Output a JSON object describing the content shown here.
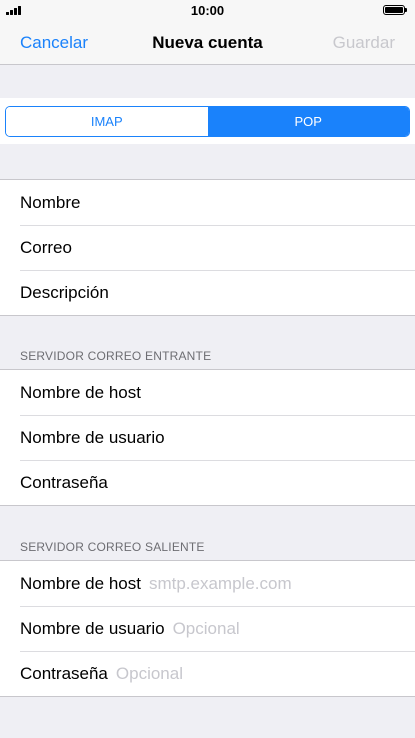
{
  "status_bar": {
    "time": "10:00",
    "signal_icon": "signal-bars-icon",
    "battery_icon": "battery-icon"
  },
  "nav": {
    "cancel": "Cancelar",
    "title": "Nueva cuenta",
    "save": "Guardar"
  },
  "segment": {
    "options": [
      "IMAP",
      "POP"
    ],
    "selected": "POP"
  },
  "account": {
    "fields": [
      "Nombre",
      "Correo",
      "Descripción"
    ]
  },
  "incoming": {
    "header": "SERVIDOR CORREO ENTRANTE",
    "fields": [
      "Nombre de host",
      "Nombre de usuario",
      "Contraseña"
    ]
  },
  "outgoing": {
    "header": "SERVIDOR CORREO SALIENTE",
    "fields": [
      {
        "label": "Nombre de host",
        "placeholder": "smtp.example.com"
      },
      {
        "label": "Nombre de usuario",
        "placeholder": "Opcional"
      },
      {
        "label": "Contraseña",
        "placeholder": "Opcional"
      }
    ]
  },
  "colors": {
    "accent": "#1a82fb",
    "disabled": "#c8c8cd",
    "placeholder": "#c7c7cd",
    "background": "#efeff4"
  }
}
